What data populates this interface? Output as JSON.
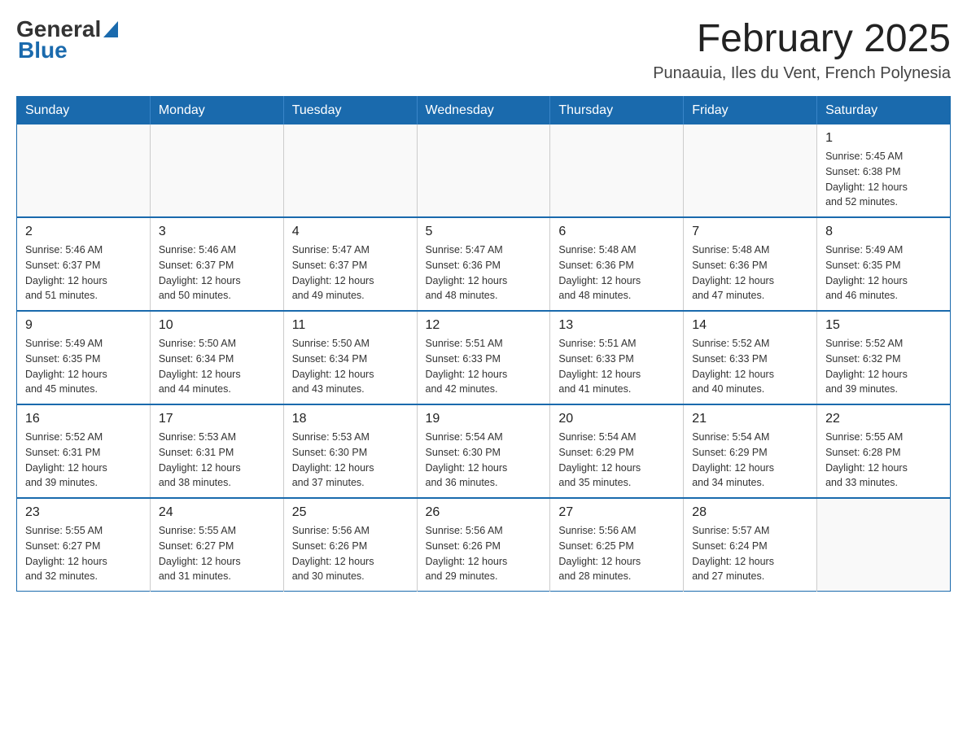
{
  "header": {
    "logo_general": "General",
    "logo_blue": "Blue",
    "month_title": "February 2025",
    "subtitle": "Punaauia, Iles du Vent, French Polynesia"
  },
  "calendar": {
    "days_of_week": [
      "Sunday",
      "Monday",
      "Tuesday",
      "Wednesday",
      "Thursday",
      "Friday",
      "Saturday"
    ],
    "weeks": [
      [
        {
          "day": "",
          "info": ""
        },
        {
          "day": "",
          "info": ""
        },
        {
          "day": "",
          "info": ""
        },
        {
          "day": "",
          "info": ""
        },
        {
          "day": "",
          "info": ""
        },
        {
          "day": "",
          "info": ""
        },
        {
          "day": "1",
          "info": "Sunrise: 5:45 AM\nSunset: 6:38 PM\nDaylight: 12 hours\nand 52 minutes."
        }
      ],
      [
        {
          "day": "2",
          "info": "Sunrise: 5:46 AM\nSunset: 6:37 PM\nDaylight: 12 hours\nand 51 minutes."
        },
        {
          "day": "3",
          "info": "Sunrise: 5:46 AM\nSunset: 6:37 PM\nDaylight: 12 hours\nand 50 minutes."
        },
        {
          "day": "4",
          "info": "Sunrise: 5:47 AM\nSunset: 6:37 PM\nDaylight: 12 hours\nand 49 minutes."
        },
        {
          "day": "5",
          "info": "Sunrise: 5:47 AM\nSunset: 6:36 PM\nDaylight: 12 hours\nand 48 minutes."
        },
        {
          "day": "6",
          "info": "Sunrise: 5:48 AM\nSunset: 6:36 PM\nDaylight: 12 hours\nand 48 minutes."
        },
        {
          "day": "7",
          "info": "Sunrise: 5:48 AM\nSunset: 6:36 PM\nDaylight: 12 hours\nand 47 minutes."
        },
        {
          "day": "8",
          "info": "Sunrise: 5:49 AM\nSunset: 6:35 PM\nDaylight: 12 hours\nand 46 minutes."
        }
      ],
      [
        {
          "day": "9",
          "info": "Sunrise: 5:49 AM\nSunset: 6:35 PM\nDaylight: 12 hours\nand 45 minutes."
        },
        {
          "day": "10",
          "info": "Sunrise: 5:50 AM\nSunset: 6:34 PM\nDaylight: 12 hours\nand 44 minutes."
        },
        {
          "day": "11",
          "info": "Sunrise: 5:50 AM\nSunset: 6:34 PM\nDaylight: 12 hours\nand 43 minutes."
        },
        {
          "day": "12",
          "info": "Sunrise: 5:51 AM\nSunset: 6:33 PM\nDaylight: 12 hours\nand 42 minutes."
        },
        {
          "day": "13",
          "info": "Sunrise: 5:51 AM\nSunset: 6:33 PM\nDaylight: 12 hours\nand 41 minutes."
        },
        {
          "day": "14",
          "info": "Sunrise: 5:52 AM\nSunset: 6:33 PM\nDaylight: 12 hours\nand 40 minutes."
        },
        {
          "day": "15",
          "info": "Sunrise: 5:52 AM\nSunset: 6:32 PM\nDaylight: 12 hours\nand 39 minutes."
        }
      ],
      [
        {
          "day": "16",
          "info": "Sunrise: 5:52 AM\nSunset: 6:31 PM\nDaylight: 12 hours\nand 39 minutes."
        },
        {
          "day": "17",
          "info": "Sunrise: 5:53 AM\nSunset: 6:31 PM\nDaylight: 12 hours\nand 38 minutes."
        },
        {
          "day": "18",
          "info": "Sunrise: 5:53 AM\nSunset: 6:30 PM\nDaylight: 12 hours\nand 37 minutes."
        },
        {
          "day": "19",
          "info": "Sunrise: 5:54 AM\nSunset: 6:30 PM\nDaylight: 12 hours\nand 36 minutes."
        },
        {
          "day": "20",
          "info": "Sunrise: 5:54 AM\nSunset: 6:29 PM\nDaylight: 12 hours\nand 35 minutes."
        },
        {
          "day": "21",
          "info": "Sunrise: 5:54 AM\nSunset: 6:29 PM\nDaylight: 12 hours\nand 34 minutes."
        },
        {
          "day": "22",
          "info": "Sunrise: 5:55 AM\nSunset: 6:28 PM\nDaylight: 12 hours\nand 33 minutes."
        }
      ],
      [
        {
          "day": "23",
          "info": "Sunrise: 5:55 AM\nSunset: 6:27 PM\nDaylight: 12 hours\nand 32 minutes."
        },
        {
          "day": "24",
          "info": "Sunrise: 5:55 AM\nSunset: 6:27 PM\nDaylight: 12 hours\nand 31 minutes."
        },
        {
          "day": "25",
          "info": "Sunrise: 5:56 AM\nSunset: 6:26 PM\nDaylight: 12 hours\nand 30 minutes."
        },
        {
          "day": "26",
          "info": "Sunrise: 5:56 AM\nSunset: 6:26 PM\nDaylight: 12 hours\nand 29 minutes."
        },
        {
          "day": "27",
          "info": "Sunrise: 5:56 AM\nSunset: 6:25 PM\nDaylight: 12 hours\nand 28 minutes."
        },
        {
          "day": "28",
          "info": "Sunrise: 5:57 AM\nSunset: 6:24 PM\nDaylight: 12 hours\nand 27 minutes."
        },
        {
          "day": "",
          "info": ""
        }
      ]
    ]
  }
}
